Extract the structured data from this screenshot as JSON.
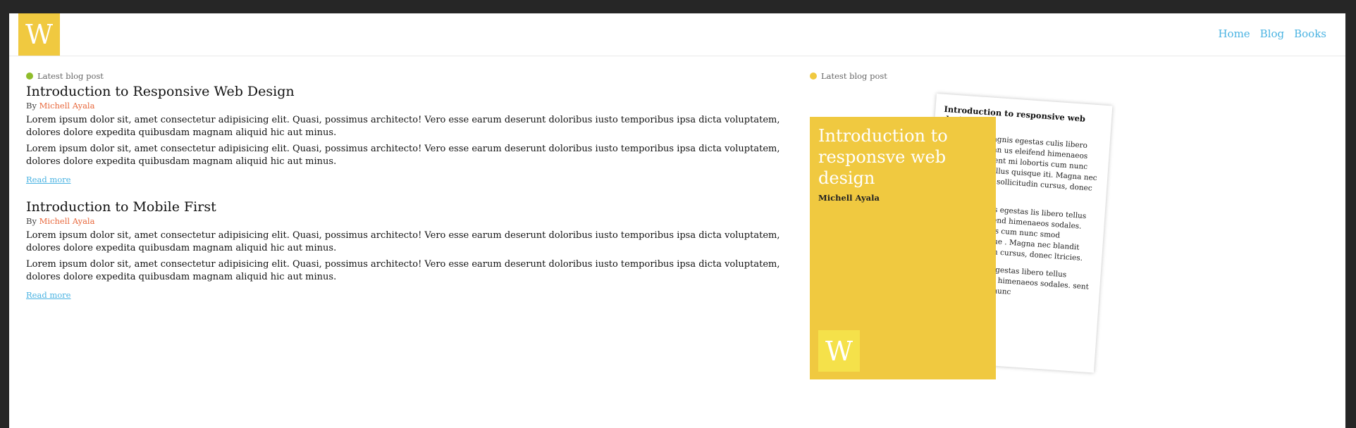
{
  "header": {
    "logo": "W",
    "nav": [
      "Home",
      "Blog",
      "Books"
    ]
  },
  "colors": {
    "accent_yellow": "#f0c940",
    "link_blue": "#4ab3e2",
    "author_orange": "#e8673b",
    "tag_green": "#8fbc2b"
  },
  "posts_section": {
    "tag": "Latest blog post",
    "posts": [
      {
        "title": "Introduction to Responsive Web Design",
        "by": "By",
        "author": "Michell Ayala",
        "paragraphs": [
          "Lorem ipsum dolor sit, amet consectetur adipisicing elit. Quasi, possimus architecto! Vero esse earum deserunt doloribus iusto temporibus ipsa dicta voluptatem, dolores dolore expedita quibusdam magnam aliquid hic aut minus.",
          "Lorem ipsum dolor sit, amet consectetur adipisicing elit. Quasi, possimus architecto! Vero esse earum deserunt doloribus iusto temporibus ipsa dicta voluptatem, dolores dolore expedita quibusdam magnam aliquid hic aut minus."
        ],
        "read_more": "Read more"
      },
      {
        "title": "Introduction to Mobile First",
        "by": "By",
        "author": "Michell Ayala",
        "paragraphs": [
          "Lorem ipsum dolor sit, amet consectetur adipisicing elit. Quasi, possimus architecto! Vero esse earum deserunt doloribus iusto temporibus ipsa dicta voluptatem, dolores dolore expedita quibusdam magnam aliquid hic aut minus.",
          "Lorem ipsum dolor sit, amet consectetur adipisicing elit. Quasi, possimus architecto! Vero esse earum deserunt doloribus iusto temporibus ipsa dicta voluptatem, dolores dolore expedita quibusdam magnam aliquid hic aut minus."
        ],
        "read_more": "Read more"
      }
    ]
  },
  "book_section": {
    "tag": "Latest blog post",
    "book": {
      "title": "Introduction to responsve web design",
      "author": "Michell Ayala",
      "logo": "W"
    },
    "paper": {
      "title": "Introduction to responsive web design",
      "paragraphs": [
        "or hac erat magnis egestas culis libero tellus accumsan us eleifend himenaeos sodales. oraesent mi lobortis cum nunc euismod phasellus quisque iti. Magna nec blandit per am sollicitudin cursus, donec ultricies.",
        "hac erat magnis egestas lis libero tellus accumsan eleifend himenaeos sodales. esent mi lobortis cum nunc smod phasellus quisque . Magna nec blandit per n sollicitudin cursus, donec ltricies.",
        "ac erat magnis egestas libero tellus accumsan eifend himenaeos sodales. sent mi lobortis cum nunc"
      ]
    }
  }
}
